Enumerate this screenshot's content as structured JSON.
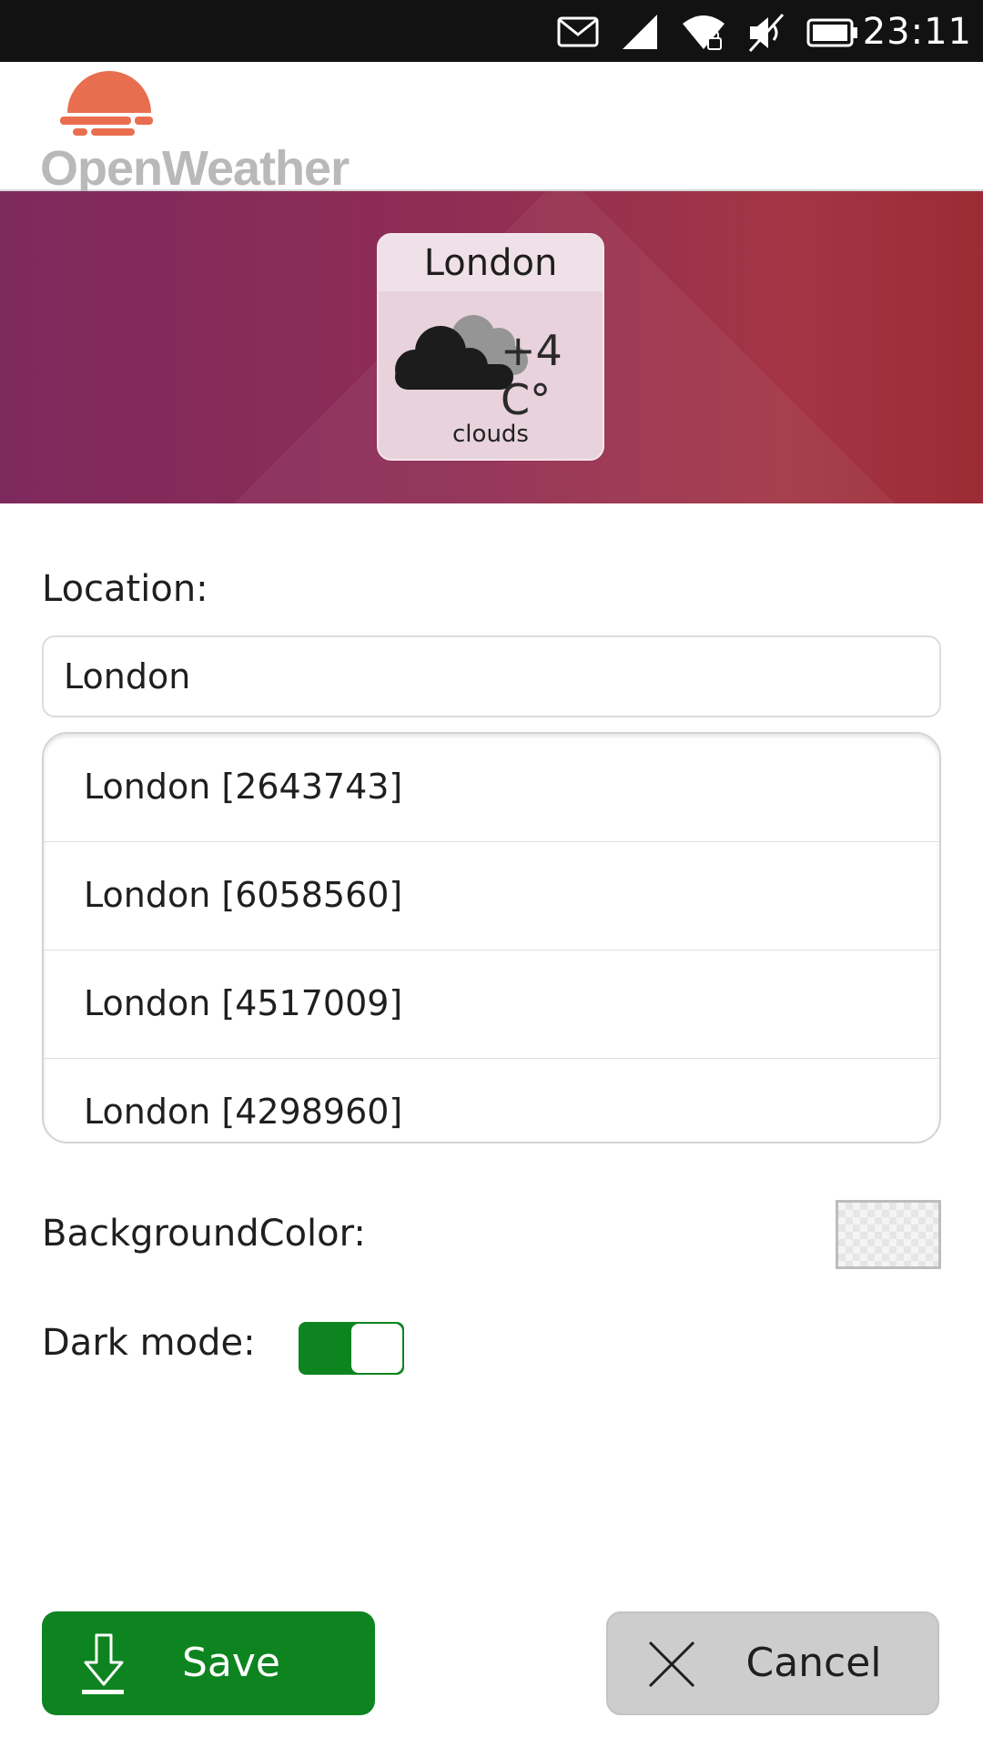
{
  "status_bar": {
    "time": "23:11",
    "icons": [
      "mail-icon",
      "cellular-signal-icon",
      "wifi-locked-icon",
      "volume-muted-icon",
      "battery-icon"
    ]
  },
  "header": {
    "logo_text": "OpenWeather",
    "logo_color": "#e96e50"
  },
  "widget": {
    "city": "London",
    "temperature": "+4 C°",
    "description": "clouds",
    "icon": "clouds-icon"
  },
  "form": {
    "location_label": "Location:",
    "location_value": "London",
    "suggestions": [
      "London [2643743]",
      "London [6058560]",
      "London [4517009]",
      "London [4298960]"
    ],
    "background_color_label": "BackgroundColor:",
    "dark_mode_label": "Dark mode:",
    "dark_mode_on": true
  },
  "buttons": {
    "save_label": "Save",
    "cancel_label": "Cancel"
  },
  "colors": {
    "accent_green": "#0e8420",
    "banner_left": "#7e295e",
    "banner_right": "#9c2b35"
  }
}
